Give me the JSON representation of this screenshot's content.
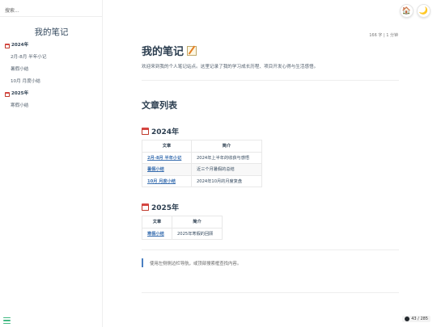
{
  "search": {
    "placeholder": "搜索..."
  },
  "sidebar": {
    "app_name": "我的笔记",
    "items": [
      {
        "label": "2024年",
        "type": "group"
      },
      {
        "label": "2月-8月 半年小记",
        "type": "item"
      },
      {
        "label": "暑假小结",
        "type": "item"
      },
      {
        "label": "10月 月度小结",
        "type": "item"
      },
      {
        "label": "2025年",
        "type": "group"
      },
      {
        "label": "寒假小结",
        "type": "item"
      }
    ]
  },
  "corner": {
    "home_icon": "🏠",
    "theme_icon": "🌙"
  },
  "meta": {
    "reading": "166 字 | 1 分钟"
  },
  "page": {
    "title": "我的笔记",
    "intro": "欢迎来到我的个人笔记站点。这里记录了我的学习成长历程、项目开发心得与生活感悟。",
    "section_title": "文章列表",
    "years": [
      {
        "heading": "2024年",
        "headers": [
          "文章",
          "简介"
        ],
        "rows": [
          [
            "2月-8月 半年小记",
            "2024年上半年的收获与感悟"
          ],
          [
            "暑假小结",
            "近三个月暑假的总结"
          ],
          [
            "10月 月度小结",
            "2024年10月的月度复盘"
          ]
        ]
      },
      {
        "heading": "2025年",
        "headers": [
          "文章",
          "简介"
        ],
        "rows": [
          [
            "寒假小结",
            "2025年寒假的回顾"
          ]
        ]
      }
    ],
    "tip": "使用左侧侧边栏导航，或顶部搜索框查找内容。"
  },
  "github": {
    "label": "43 / 285"
  },
  "colors": {
    "accent": "#42b983",
    "link": "#3a6fb0",
    "text": "#34495e"
  }
}
